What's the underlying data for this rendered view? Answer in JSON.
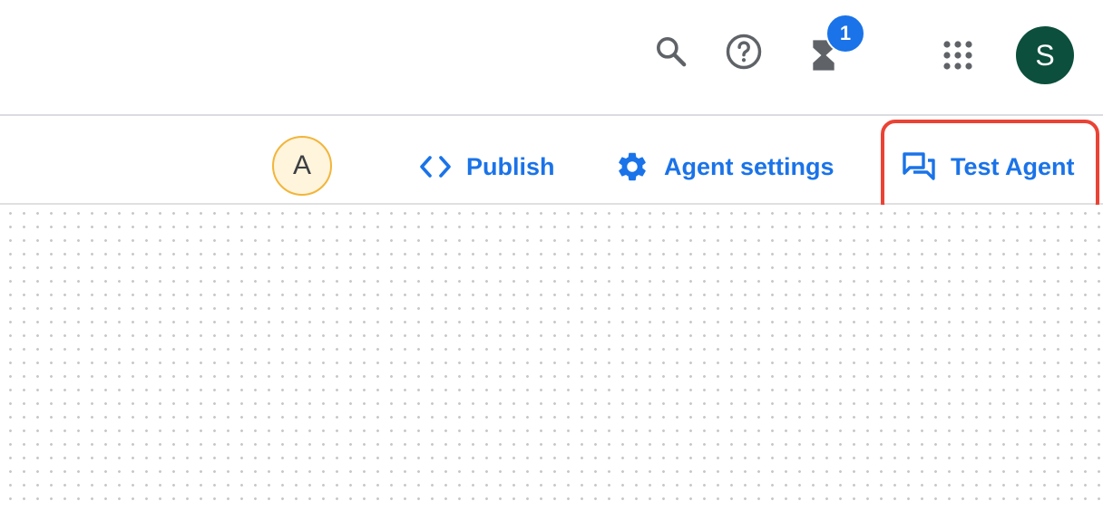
{
  "header": {
    "icons": {
      "search": "search-icon",
      "help": "help-circle-icon",
      "tasks": "hourglass-icon",
      "apps": "apps-grid-icon"
    },
    "tasks_badge_count": "1",
    "user_avatar_letter": "S"
  },
  "toolbar": {
    "collaborator_avatar_letter": "A",
    "publish_label": "Publish",
    "settings_label": "Agent settings",
    "test_label": "Test Agent"
  },
  "colors": {
    "accent": "#1a73e8",
    "highlight": "#ea4335",
    "user_avatar": "#0b4f3c",
    "collaborator_avatar_bg": "#fff4dc",
    "collaborator_avatar_border": "#f2b53a"
  }
}
